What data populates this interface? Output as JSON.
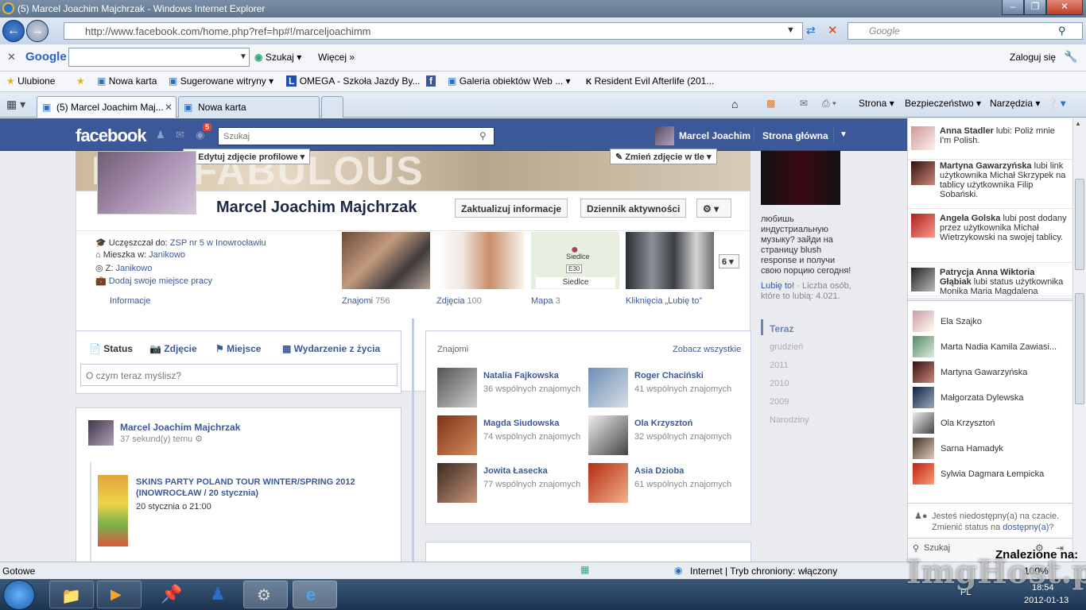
{
  "window": {
    "title": "(5) Marcel Joachim Majchrzak - Windows Internet Explorer"
  },
  "address": {
    "url": "http://www.facebook.com/home.php?ref=hp#!/marceljoachimm",
    "search_placeholder": "Google"
  },
  "googlebar": {
    "brand": "Google",
    "search_label": "Szukaj",
    "more_label": "Więcej",
    "login_label": "Zaloguj się"
  },
  "favorites": {
    "label": "Ulubione",
    "items": [
      "Nowa karta",
      "Sugerowane witryny",
      "OMEGA - Szkoła Jazdy By...",
      "Galeria obiektów Web ...",
      "Resident Evil Afterlife (201..."
    ]
  },
  "tabs": [
    {
      "label": "(5) Marcel Joachim Maj..."
    },
    {
      "label": "Nowa karta"
    }
  ],
  "commands": {
    "page": "Strona",
    "security": "Bezpieczeństwo",
    "tools": "Narzędzia"
  },
  "facebook": {
    "logo": "facebook",
    "notif_count": "5",
    "search_placeholder": "Szukaj",
    "user_name": "Marcel Joachim",
    "home_label": "Strona główna"
  },
  "cover": {
    "text": "I AM FABULOUS",
    "edit_profile_photo": "Edytuj zdjęcie profilowe",
    "change_cover": "Zmień zdjęcie w tle"
  },
  "profile": {
    "name": "Marcel Joachim Majchrzak",
    "update_info": "Zaktualizuj informacje",
    "activity_log": "Dziennik aktywności",
    "info": [
      {
        "prefix": "Uczęszczał do: ",
        "link": "ZSP nr 5 w Inowrocławiu"
      },
      {
        "prefix": "Mieszka w: ",
        "link": "Janikowo"
      },
      {
        "prefix": "Z: ",
        "link": "Janikowo"
      },
      {
        "prefix": "",
        "link": "Dodaj swoje miejsce pracy"
      }
    ],
    "info_link": "Informacje",
    "sections": [
      {
        "label": "Znajomi",
        "count": "756"
      },
      {
        "label": "Zdjęcia",
        "count": "100"
      },
      {
        "label": "Mapa",
        "count": "3"
      },
      {
        "label": "Kliknięcia „Lubię to”",
        "count": ""
      }
    ],
    "map_place": "Siedlce",
    "map_road": "E30",
    "more_count": "6"
  },
  "composer": {
    "tabs": [
      "Status",
      "Zdjęcie",
      "Miejsce",
      "Wydarzenie z życia"
    ],
    "placeholder": "O czym teraz myślisz?"
  },
  "post": {
    "author": "Marcel Joachim Majchrzak",
    "time": "37 sekund(y) temu",
    "event_title": "SKINS PARTY POLAND TOUR WINTER/SPRING 2012 (INOWROCŁAW / 20 stycznia)",
    "event_date": "20 stycznia o 21:00"
  },
  "friends_box": {
    "title": "Znajomi",
    "see_all": "Zobacz wszystkie",
    "items": [
      {
        "name": "Natalia Fajkowska",
        "mutual": "36 wspólnych znajomych"
      },
      {
        "name": "Roger Chaciński",
        "mutual": "41 wspólnych znajomych"
      },
      {
        "name": "Magda Siudowska",
        "mutual": "74 wspólnych znajomych"
      },
      {
        "name": "Ola Krzysztoń",
        "mutual": "32 wspólnych znajomych"
      },
      {
        "name": "Jowita Łasecka",
        "mutual": "77 wspólnych znajomych"
      },
      {
        "name": "Asia Dzioba",
        "mutual": "61 wspólnych znajomych"
      }
    ]
  },
  "ad": {
    "text": "любишь индустриальную музыку? зайди на страницу blush response и получи свою порцию сегодня!",
    "like": "Lubię to!",
    "likes_text": " · Liczba osób, które to lubią: 4.021."
  },
  "timeline": {
    "years": [
      "Teraz",
      "grudzień",
      "2011",
      "2010",
      "2009",
      "Narodziny"
    ]
  },
  "ticker": [
    {
      "name": "Anna Stadler",
      "text": " lubi: Poliż mnie I'm Polish."
    },
    {
      "name": "Martyna Gawarzyńska",
      "text": " lubi link użytkownika Michał Skrzypek na tablicy użytkownika Filip Sobański."
    },
    {
      "name": "Angela Golska",
      "text": " lubi post dodany przez użytkownika Michał Wietrzykowski na swojej tablicy."
    },
    {
      "name": "Patrycja Anna Wiktoria Głąbiak",
      "text": " lubi status użytkownika Monika Maria Magdalena"
    }
  ],
  "chat": {
    "friends": [
      "Ela Szajko",
      "Marta Nadia Kamila Zawiasi...",
      "Martyna Gawarzyńska",
      "Małgorzata Dylewska",
      "Ola Krzysztoń",
      "Sarna Hamadyk",
      "Sylwia Dagmara Łempicka"
    ],
    "offline_text": "Jesteś niedostępny(a) na czacie. Zmienić status na ",
    "offline_link": "dostępny(a)",
    "search": "Szukaj"
  },
  "statusbar": {
    "left": "Gotowe",
    "zone": "Internet | Tryb chroniony: włączony",
    "zoom": "100%"
  },
  "watermark": {
    "found": "Znalezione na:",
    "logo": "ImgHost.pl"
  },
  "taskbar": {
    "lang": "PL",
    "time": "18:54",
    "date": "2012-01-13"
  }
}
